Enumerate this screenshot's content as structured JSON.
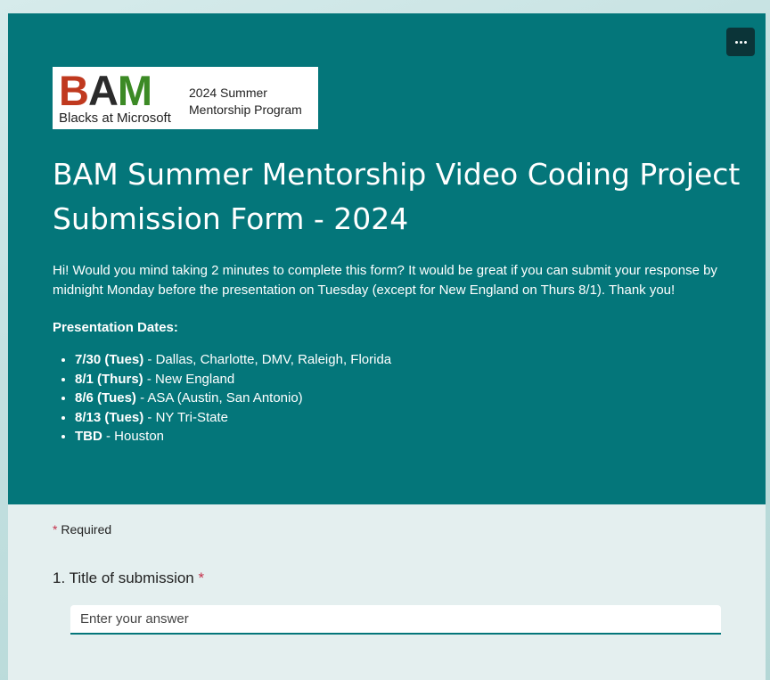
{
  "header": {
    "more_options_label": "More options",
    "logo": {
      "bam_b": "B",
      "bam_a": "A",
      "bam_m": "M",
      "org_name": "Blacks at Microsoft",
      "program_name": "2024 Summer Mentorship Program"
    },
    "title": "BAM Summer Mentorship Video Coding Project Submission Form - 2024",
    "description": "Hi! Would you mind taking 2 minutes to complete this form? It would be great if you can submit your response by midnight Monday before the presentation on Tuesday (except for New England on Thurs 8/1). Thank you!",
    "dates_heading": "Presentation Dates:",
    "dates": [
      {
        "date": "7/30 (Tues)",
        "locations": " - Dallas, Charlotte, DMV, Raleigh, Florida"
      },
      {
        "date": "8/1 (Thurs)",
        "locations": " - New England"
      },
      {
        "date": "8/6 (Tues)",
        "locations": " - ASA (Austin, San Antonio)"
      },
      {
        "date": "8/13 (Tues)",
        "locations": " - NY Tri-State"
      },
      {
        "date": "TBD",
        "locations": " - Houston"
      }
    ]
  },
  "form": {
    "required_star": "*",
    "required_label": "Required",
    "questions": [
      {
        "number": "1.",
        "label": "Title of submission",
        "required_star": "*",
        "placeholder": "Enter your answer",
        "value": ""
      }
    ]
  },
  "colors": {
    "header_bg": "#04767a",
    "required_star": "#c4314b",
    "body_bg": "#e4efef"
  },
  "icons": {
    "more_options": "ellipsis-icon"
  }
}
